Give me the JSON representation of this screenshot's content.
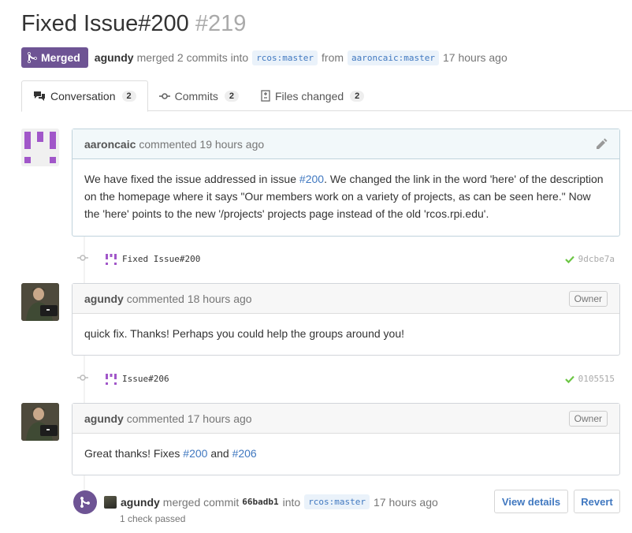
{
  "pr": {
    "title": "Fixed Issue#200",
    "number": "#219",
    "state_label": "Merged",
    "author": "agundy",
    "merge_text": "merged 2 commits into",
    "base_branch": "rcos:master",
    "from_text": "from",
    "head_branch": "aaroncaic:master",
    "time": "17 hours ago"
  },
  "tabs": [
    {
      "label": "Conversation",
      "count": "2",
      "icon": "comment-discussion-icon"
    },
    {
      "label": "Commits",
      "count": "2",
      "icon": "git-commit-icon"
    },
    {
      "label": "Files changed",
      "count": "2",
      "icon": "diff-icon"
    }
  ],
  "comments": [
    {
      "author": "aaroncaic",
      "action": "commented 19 hours ago",
      "body_pre": "We have fixed the issue addressed in issue ",
      "body_link": "#200",
      "body_post": ". We changed the link in the word 'here' of the description on the homepage where it says \"Our members work on a variety of projects, as can be seen here.\" Now the 'here' points to the new '/projects' projects page instead of the old 'rcos.rpi.edu'."
    },
    {
      "author": "agundy",
      "action": "commented 18 hours ago",
      "badge": "Owner",
      "body": "quick fix. Thanks! Perhaps you could help the groups around you!"
    },
    {
      "author": "agundy",
      "action": "commented 17 hours ago",
      "badge": "Owner",
      "body_pre": "Great thanks! Fixes ",
      "link1": "#200",
      "mid": " and ",
      "link2": "#206"
    }
  ],
  "commits": [
    {
      "message": "Fixed Issue#200",
      "sha": "9dcbe7a"
    },
    {
      "message": "Issue#206",
      "sha": "0105515"
    }
  ],
  "merge_event": {
    "author": "agundy",
    "text": "merged commit",
    "sha": "66badb1",
    "into": "into",
    "branch": "rcos:master",
    "time": "17 hours ago",
    "check": "1 check passed",
    "view_details": "View details",
    "revert": "Revert"
  },
  "colors": {
    "merged": "#6e5494",
    "link": "#4078c0",
    "success": "#6cc644"
  }
}
